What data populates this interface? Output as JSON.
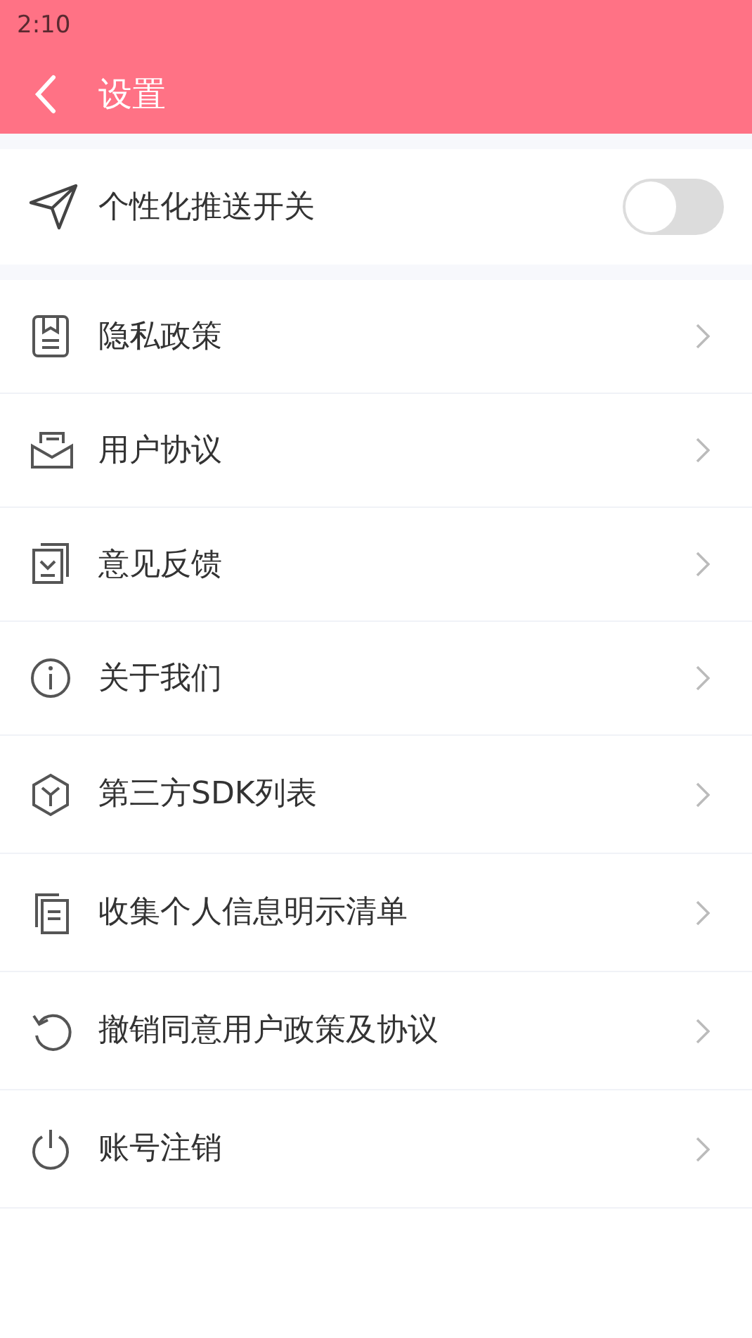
{
  "status_bar": {
    "time": "2:10"
  },
  "header": {
    "title": "设置"
  },
  "push_toggle": {
    "label": "个性化推送开关",
    "on": false
  },
  "menu": [
    {
      "label": "隐私政策"
    },
    {
      "label": "用户协议"
    },
    {
      "label": "意见反馈"
    },
    {
      "label": "关于我们"
    },
    {
      "label": "第三方SDK列表"
    },
    {
      "label": "收集个人信息明示清单"
    },
    {
      "label": "撤销同意用户政策及协议"
    },
    {
      "label": "账号注销"
    }
  ]
}
